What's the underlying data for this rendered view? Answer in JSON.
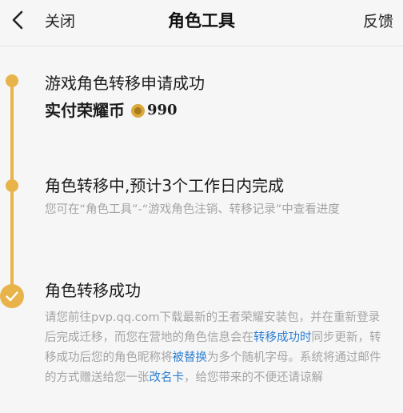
{
  "header": {
    "close_label": "关闭",
    "title": "角色工具",
    "feedback_label": "反馈"
  },
  "steps": [
    {
      "title": "游戏角色转移申请成功",
      "sub_label": "实付荣耀币",
      "sub_amount": "990"
    },
    {
      "title": "角色转移中,预计3个工作日内完成",
      "desc": "您可在“角色工具”-“游戏角色注销、转移记录”中查看进度"
    },
    {
      "title": "角色转移成功",
      "desc_parts": [
        "请您前往pvp.qq.com下载最新的王者荣耀安装包，并在重新登录后完成迁移，而您在营地的角色信息会在",
        "转移成功时",
        "同步更新，转移成功后您的角色昵称将",
        "被替换",
        "为多个随机字母。系统将通过邮件的方式赠送给您一张",
        "改名卡",
        "，给您带来的不便还请谅解"
      ]
    }
  ],
  "colors": {
    "accent": "#e8b44a",
    "link": "#2d7fd0",
    "muted": "#a4a4a4"
  },
  "icons": {
    "back": "chevron-left-icon",
    "coin": "coin-icon",
    "check": "check-icon"
  }
}
